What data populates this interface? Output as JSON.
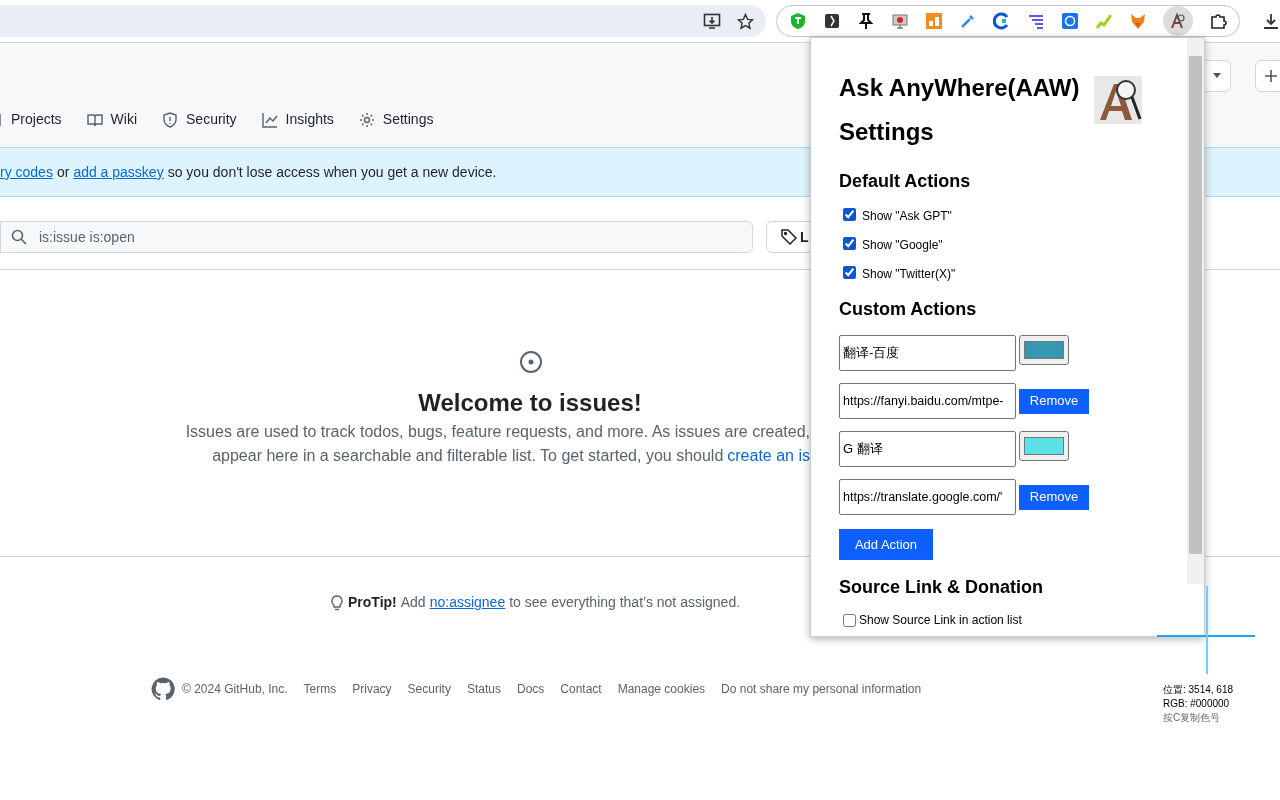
{
  "repo_tabs": [
    {
      "label": "Projects"
    },
    {
      "label": "Wiki"
    },
    {
      "label": "Security"
    },
    {
      "label": "Insights"
    },
    {
      "label": "Settings"
    }
  ],
  "banner": {
    "segments": [
      {
        "kind": "link",
        "text": "ry codes"
      },
      {
        "kind": "text",
        "text": "or"
      },
      {
        "kind": "link",
        "text": "add a passkey"
      },
      {
        "kind": "text",
        "text": "so you don't lose access when you get a new device."
      }
    ]
  },
  "search": {
    "value": "is:issue is:open"
  },
  "labels_button": {
    "label": "L"
  },
  "empty_state": {
    "title": "Welcome to issues!",
    "line_1": "Issues are used to track todos, bugs, feature requests, and more. As issues are created,",
    "line_2": "appear here in a searchable and filterable list. To get started, you should",
    "link": "create an is"
  },
  "protip": {
    "label": "ProTip!",
    "before": "Add",
    "link": "no:assignee",
    "after": "to see everything that’s not assigned."
  },
  "footer": {
    "copyright": "© 2024 GitHub, Inc.",
    "links": [
      "Terms",
      "Privacy",
      "Security",
      "Status",
      "Docs",
      "Contact",
      "Manage cookies",
      "Do not share my personal information"
    ]
  },
  "popup": {
    "title": "Ask AnyWhere(AAW) Settings",
    "default_heading": "Default Actions",
    "default_actions": [
      {
        "label": "Show \"Ask GPT\"",
        "checked": true
      },
      {
        "label": "Show \"Google\"",
        "checked": true
      },
      {
        "label": "Show \"Twitter(X)\"",
        "checked": true
      }
    ],
    "custom_heading": "Custom Actions",
    "custom_actions": [
      {
        "name": "翻译-百度",
        "url": "https://fanyi.baidu.com/mtpe-",
        "color": "#3597b0",
        "remove": "Remove"
      },
      {
        "name": "G 翻译",
        "url": "https://translate.google.com/'",
        "color": "#5ddfe6",
        "remove": "Remove"
      }
    ],
    "add_button": "Add Action",
    "source_heading": "Source Link & Donation",
    "source_option": {
      "label": "Show Source Link in action list",
      "checked": false
    }
  },
  "color_picker": {
    "position": "位置: 3514, 618",
    "rgb": "RGB: #000000",
    "hint": "按C复制色号"
  }
}
